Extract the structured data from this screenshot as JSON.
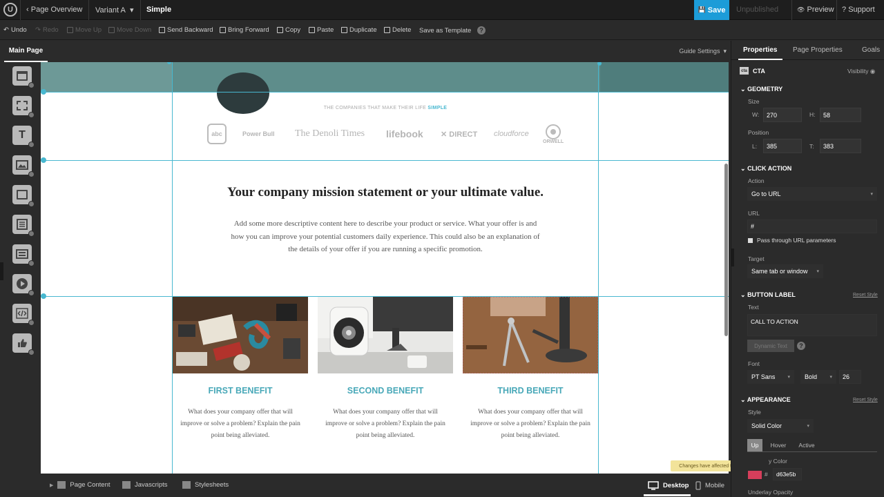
{
  "topbar": {
    "logo_text": "U",
    "back_arrow": "‹",
    "page_overview": "Page Overview",
    "variant": "Variant A",
    "variant_caret": "▾",
    "page_title": "Simple",
    "save_icon": "💾",
    "save": "Save",
    "unpublished": "Unpublished",
    "preview_icon": "👁",
    "preview": "Preview",
    "support_icon": "?",
    "support": "Support"
  },
  "toolbar": {
    "undo": "Undo",
    "redo": "Redo",
    "move_up": "Move Up",
    "move_down": "Move Down",
    "send_backward": "Send Backward",
    "bring_forward": "Bring Forward",
    "copy": "Copy",
    "paste": "Paste",
    "duplicate": "Duplicate",
    "delete": "Delete",
    "save_as_template": "Save as Template",
    "help": "?"
  },
  "page_tabs": {
    "main_page": "Main Page",
    "guide_settings": "Guide Settings",
    "guide_caret": "▾"
  },
  "tools": {
    "text_glyph": "T"
  },
  "canvas": {
    "companies_prefix": "THE COMPANIES THAT MAKE THEIR LIFE",
    "companies_highlight": "SIMPLE",
    "logos": {
      "abc": "abc",
      "powerbull": "Power Bull",
      "denoli": "The Denoli Times",
      "lifebook": "lifebook",
      "direct": "✕ DIRECT",
      "cloudforce": "cloudforce",
      "orwell": "ORWELL"
    },
    "mission_title": "Your company mission statement or your ultimate value.",
    "mission_body": "Add some more descriptive content here to describe your product or service. What your offer is and how you can improve your potential customers daily experience. This could also be an explanation of the details of your offer if you are running a specific promotion.",
    "benefits": [
      {
        "title": "FIRST BENEFIT",
        "text": "What does your company offer that will improve or solve a problem? Explain the pain point being alleviated."
      },
      {
        "title": "SECOND BENEFIT",
        "text": "What does your company offer that will improve or solve a problem? Explain the pain point being alleviated."
      },
      {
        "title": "THIRD BENEFIT",
        "text": "What does your company offer that will improve or solve a problem? Explain the pain point being alleviated."
      }
    ]
  },
  "bottombar": {
    "page_content": "Page Content",
    "javascripts": "Javascripts",
    "stylesheets": "Stylesheets",
    "desktop": "Desktop",
    "mobile": "Mobile",
    "toast": "Changes have affected the other view"
  },
  "properties": {
    "tabs": {
      "properties": "Properties",
      "page_properties": "Page Properties",
      "goals": "Goals"
    },
    "element_badge": "cta",
    "element_type": "CTA",
    "visibility": "Visibility",
    "geometry": {
      "title": "GEOMETRY",
      "size_label": "Size",
      "w_label": "W:",
      "w": "270",
      "h_label": "H:",
      "h": "58",
      "position_label": "Position",
      "l_label": "L:",
      "l": "385",
      "t_label": "T:",
      "t": "383"
    },
    "click_action": {
      "title": "CLICK ACTION",
      "action_label": "Action",
      "action_value": "Go to URL",
      "url_label": "URL",
      "url_value": "#",
      "pass_through": "Pass through URL parameters",
      "target_label": "Target",
      "target_value": "Same tab or window"
    },
    "button_label": {
      "title": "BUTTON LABEL",
      "reset": "Reset Style",
      "text_label": "Text",
      "text_value": "CALL TO ACTION",
      "dynamic_text": "Dynamic Text",
      "font_label": "Font",
      "font_family": "PT Sans",
      "font_weight": "Bold",
      "font_size": "26"
    },
    "appearance": {
      "title": "APPEARANCE",
      "reset": "Reset Style",
      "style_label": "Style",
      "style_value": "Solid Color",
      "state_up": "Up",
      "state_hover": "Hover",
      "state_active": "Active",
      "color_label": "y Color",
      "color_value": "d63e5b",
      "underlay_label": "Underlay Opacity"
    },
    "caret": "▾",
    "chevron": "⌄"
  }
}
